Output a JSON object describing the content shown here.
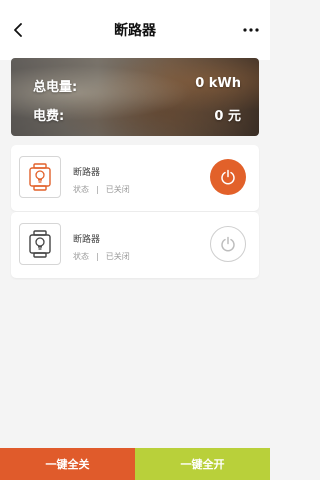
{
  "header": {
    "title": "断路器",
    "back_icon": "chevron-left-icon",
    "more_icon": "more-horizontal-icon"
  },
  "summary": {
    "energy_label": "总电量:",
    "energy_value": "0 kWh",
    "fee_label": "电费:",
    "fee_value": "0 元"
  },
  "devices": [
    {
      "name": "断路器",
      "status_label": "状态",
      "separator": "|",
      "status_value": "已关闭",
      "icon": "breaker-device-icon",
      "icon_color": "#e2612a",
      "power_icon": "power-icon"
    },
    {
      "name": "断路器",
      "status_label": "状态",
      "separator": "|",
      "status_value": "已关闭",
      "icon": "breaker-device-icon",
      "icon_color": "#444444",
      "power_icon": "power-icon"
    }
  ],
  "actions": {
    "all_off_label": "一键全关",
    "all_on_label": "一键全开"
  },
  "colors": {
    "accent_orange": "#e05b2b",
    "accent_green": "#b9d03a"
  }
}
